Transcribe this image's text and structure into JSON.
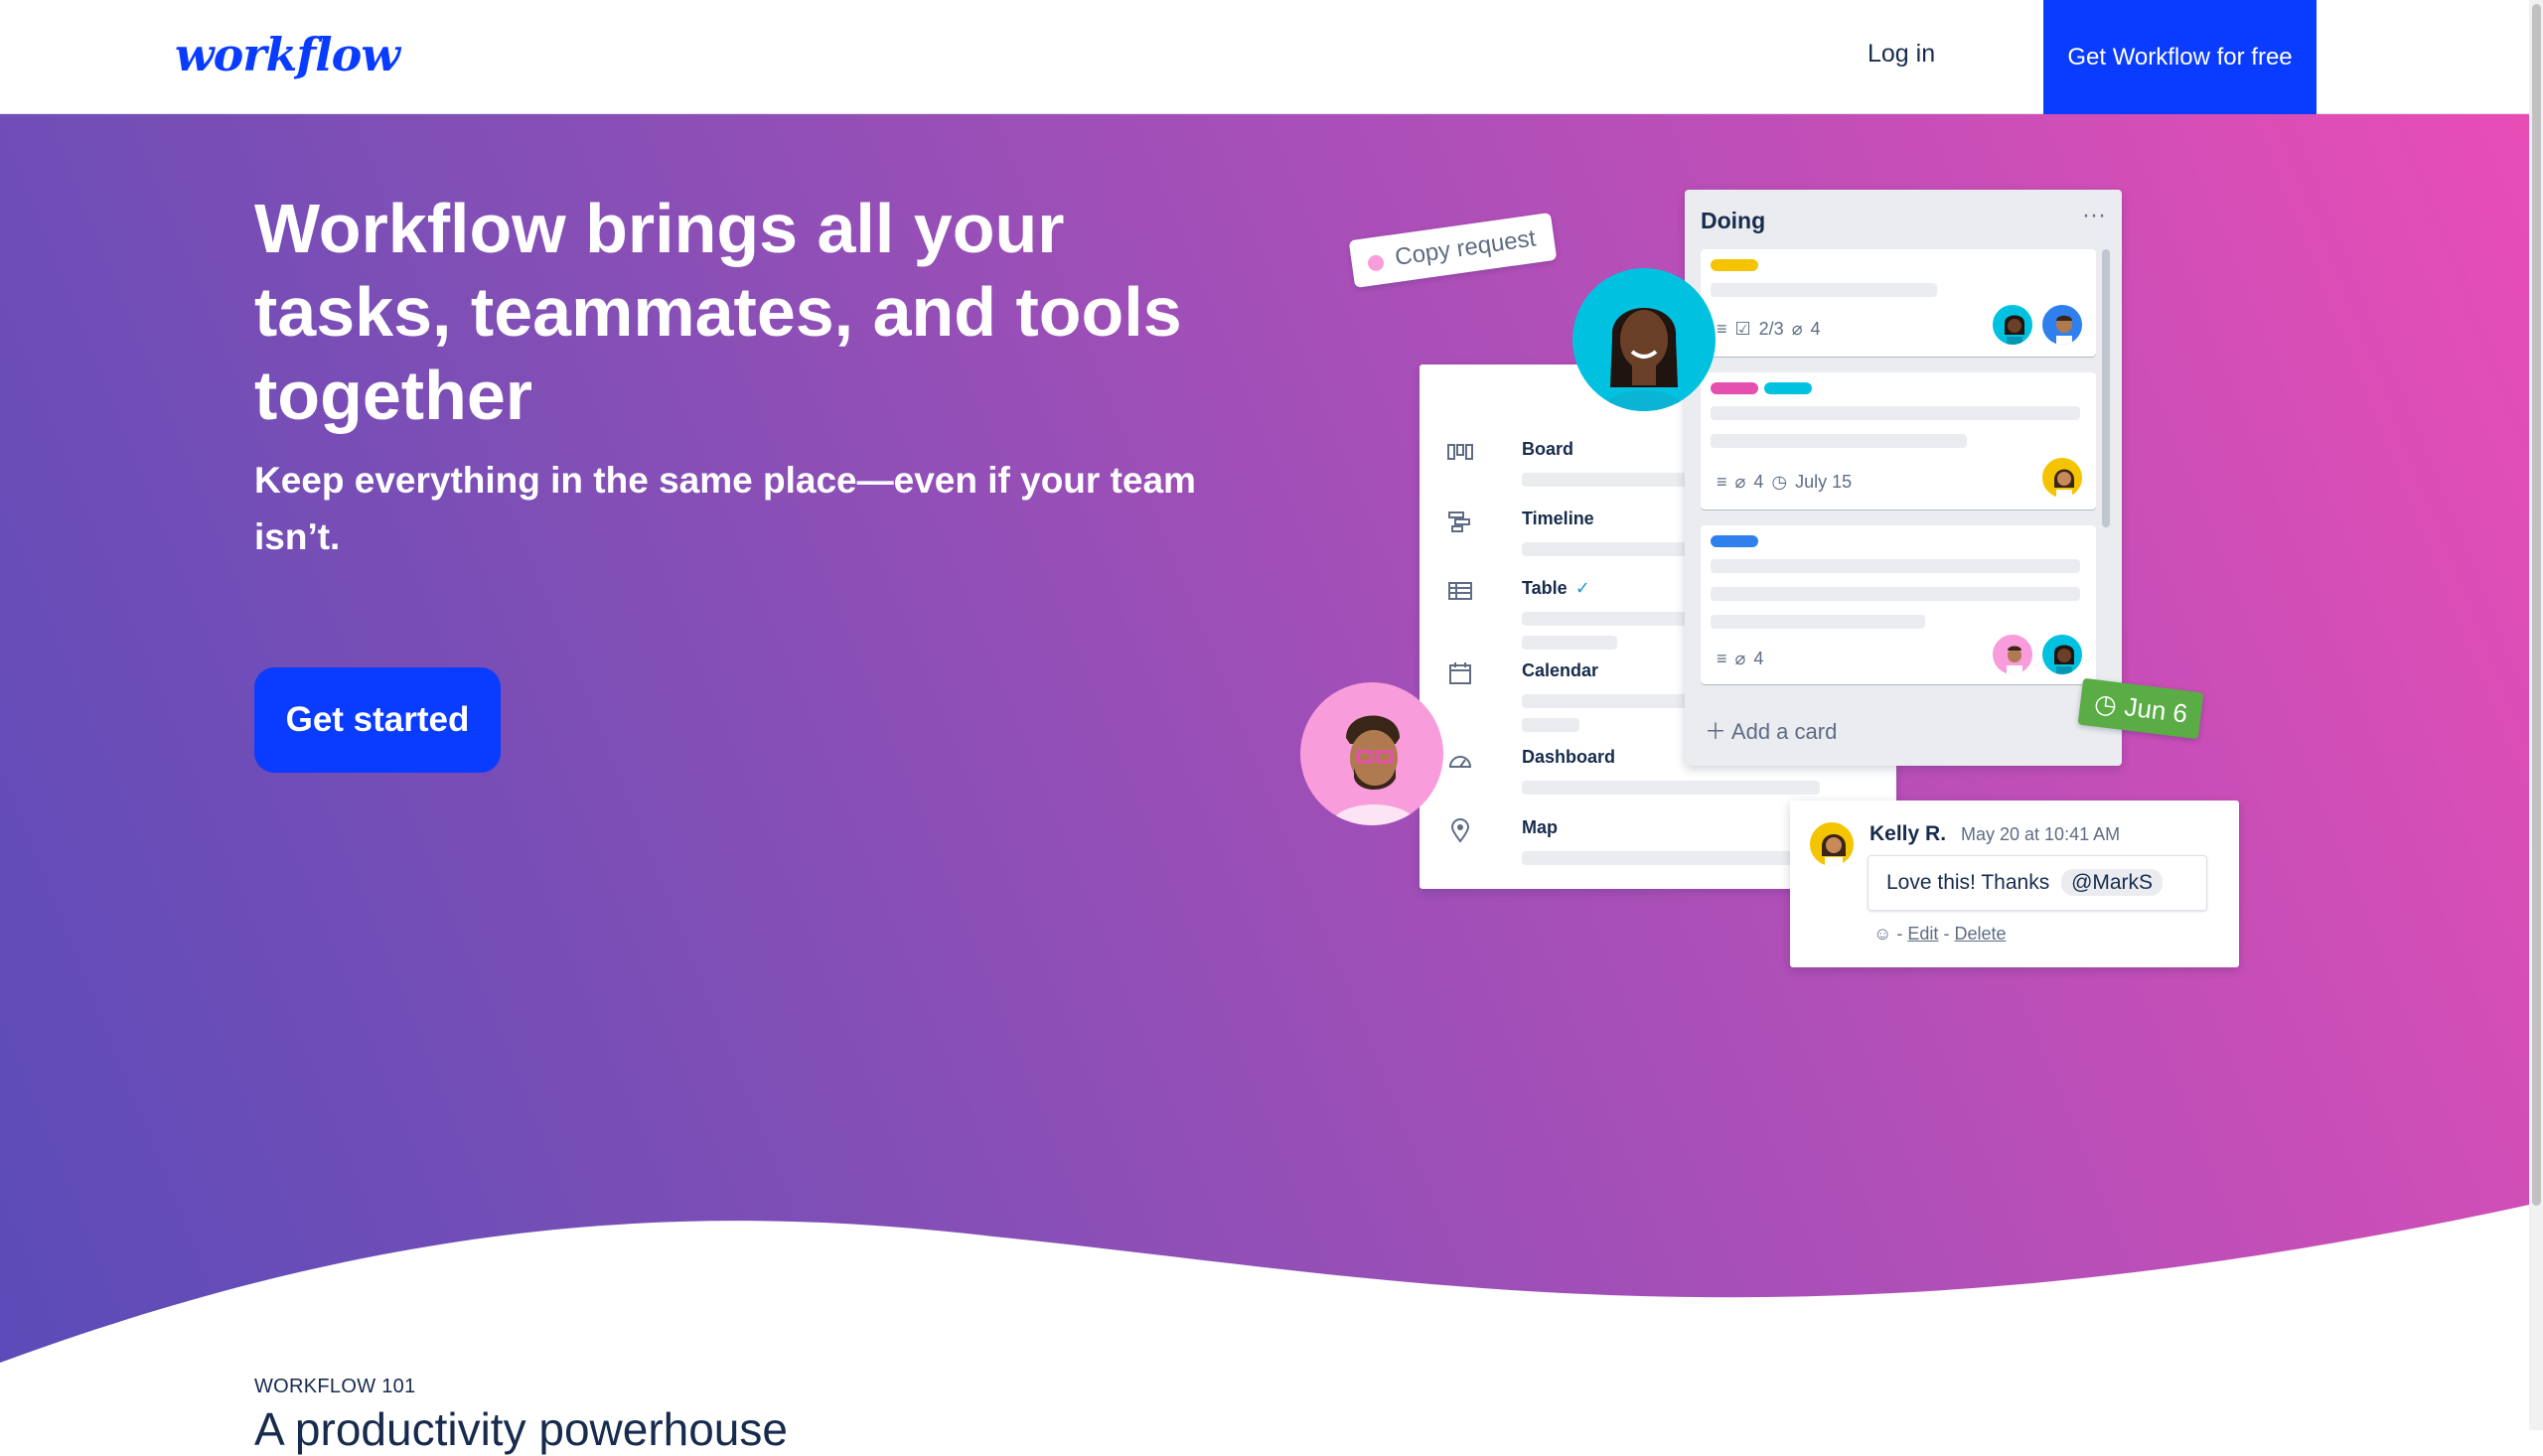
{
  "header": {
    "logo": "workflow",
    "login_label": "Log in",
    "cta_label": "Get Workflow for free"
  },
  "hero": {
    "headline": "Workflow brings all your tasks, teammates, and tools together",
    "subhead": "Keep everything in the same place—even if your team isn’t.",
    "get_started_label": "Get started"
  },
  "illustration": {
    "copy_tag": "Copy request",
    "views": [
      {
        "label": "Board",
        "icon": "board-icon"
      },
      {
        "label": "Timeline",
        "icon": "timeline-icon"
      },
      {
        "label": "Table",
        "icon": "table-icon",
        "checked": true
      },
      {
        "label": "Calendar",
        "icon": "calendar-icon"
      },
      {
        "label": "Dashboard",
        "icon": "dashboard-icon"
      },
      {
        "label": "Map",
        "icon": "map-pin-icon"
      }
    ],
    "list": {
      "title": "Doing",
      "menu": "···",
      "cards": [
        {
          "checklist": "2/3",
          "attachments": "4"
        },
        {
          "attachments": "4",
          "due": "July 15"
        },
        {
          "attachments": "4"
        }
      ],
      "add_card_label": "Add a card"
    },
    "date_tag": "Jun 6",
    "comment": {
      "author": "Kelly R.",
      "time": "May 20 at 10:41 AM",
      "text": "Love this! Thanks",
      "mention": "@MarkS",
      "separator": " - ",
      "edit_label": "Edit",
      "delete_label": "Delete"
    },
    "colors": {
      "yellow": "#f5c400",
      "pink": "#e44fb0",
      "cyan": "#00c2e0",
      "blue": "#2f80ed",
      "green": "#5aac44"
    }
  },
  "section": {
    "kicker": "WORKFLOW 101",
    "title": "A productivity powerhouse"
  }
}
